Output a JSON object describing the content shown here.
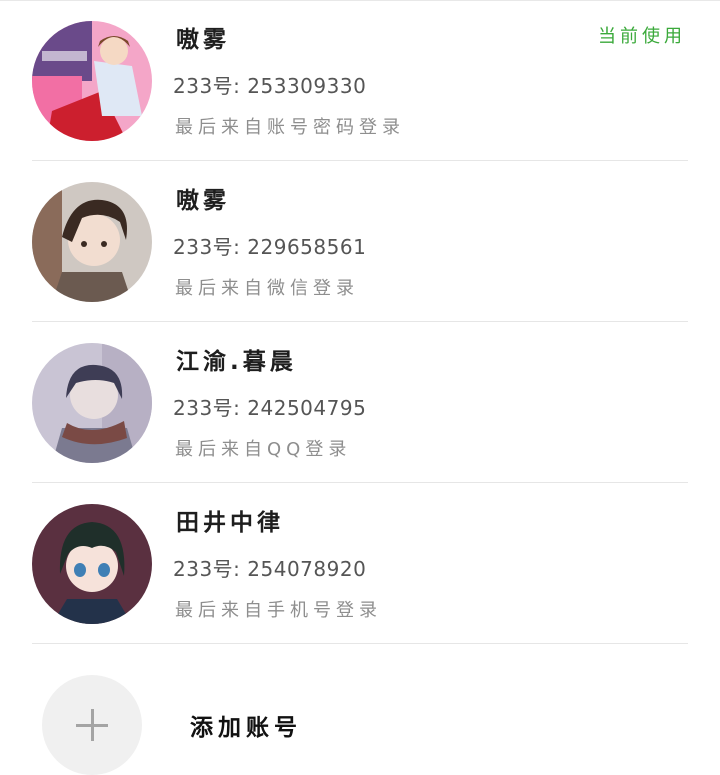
{
  "accounts": [
    {
      "name": "嗷雾",
      "number_label": "233号: 253309330",
      "last_login": "最后来自账号密码登录",
      "current_label": "当前使用",
      "avatar_icon": "anime-boy-pink-background-avatar",
      "is_current": true
    },
    {
      "name": "嗷雾",
      "number_label": "233号: 229658561",
      "last_login": "最后来自微信登录",
      "avatar_icon": "anime-boy-brown-hair-avatar"
    },
    {
      "name": "江渝.暮晨",
      "number_label": "233号: 242504795",
      "last_login": "最后来自QQ登录",
      "avatar_icon": "anime-boy-scarf-avatar"
    },
    {
      "name": "田井中律",
      "number_label": "233号: 254078920",
      "last_login": "最后来自手机号登录",
      "avatar_icon": "anime-girl-green-hair-avatar"
    }
  ],
  "add_account": {
    "label": "添加账号",
    "icon": "plus-icon"
  },
  "colors": {
    "current_accent": "#3aa93a",
    "divider": "#e6e6e6",
    "secondary_text": "#8e8e8e"
  }
}
